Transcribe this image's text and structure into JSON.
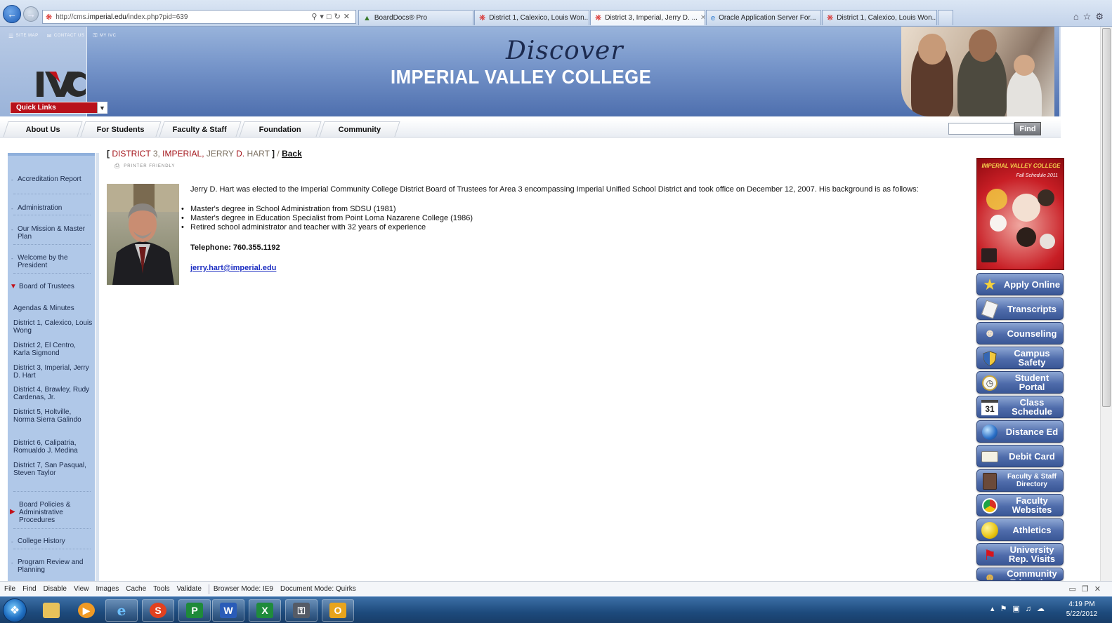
{
  "browser": {
    "address": "http://cms.imperial.edu/index.php?pid=639",
    "address_host": "imperial.edu",
    "address_prefix": "http://cms.",
    "address_suffix": "/index.php?pid=639",
    "tabs": [
      {
        "label": "BoardDocs® Pro",
        "active": false
      },
      {
        "label": "District 1, Calexico, Louis Won...",
        "active": false
      },
      {
        "label": "District 3, Imperial, Jerry D. ...",
        "active": true
      },
      {
        "label": "Oracle Application Server For...",
        "active": false
      },
      {
        "label": "District 1, Calexico, Louis Won...",
        "active": false
      }
    ]
  },
  "header": {
    "util_links": [
      "SITE MAP",
      "CONTACT US",
      "MY IVC"
    ],
    "quick_links": "Quick Links",
    "discover": "Discover",
    "college_name": "IMPERIAL VALLEY COLLEGE"
  },
  "nav": {
    "tabs": [
      "About Us",
      "For Students",
      "Faculty & Staff",
      "Foundation",
      "Community"
    ],
    "search_placeholder": "",
    "find_label": "Find"
  },
  "sidebar": {
    "items": [
      "Accreditation Report",
      "Administration",
      "Our Mission & Master Plan",
      "Welcome by the President",
      "Board of Trustees",
      "Board Policies & Administrative Procedures",
      "College History",
      "Program Review and Planning"
    ],
    "sub_items": [
      "Agendas & Minutes",
      "District 1, Calexico, Louis Wong",
      "District 2, El Centro, Karla Sigmond",
      "District 3, Imperial, Jerry D. Hart",
      "District 4, Brawley, Rudy Cardenas, Jr.",
      "District 5, Holtville, Norma Sierra Galindo",
      "District 6, Calipatria, Romualdo J. Medina",
      "District 7, San Pasqual, Steven Taylor"
    ]
  },
  "content": {
    "breadcrumb": {
      "open": "[",
      "district_word": "DISTRICT",
      "district_num": "3,",
      "city": "IMPERIAL,",
      "first": "JERRY",
      "initial": "D.",
      "last": "HART",
      "close": "]",
      "slash": "/",
      "back": "Back"
    },
    "printer_friendly": "PRINTER FRIENDLY",
    "bio": "Jerry D. Hart was elected to the Imperial Community College District Board of Trustees for Area 3 encompassing Imperial Unified School District and took office on December 12, 2007. His background is as follows:",
    "credentials": [
      "Master's degree in School Administration from SDSU (1981)",
      "Master's degree in Education Specialist from Point Loma Nazarene College (1986)",
      "Retired school administrator and teacher with 32 years of experience"
    ],
    "telephone": "Telephone: 760.355.1192",
    "email": "jerry.hart@imperial.edu"
  },
  "right_column": {
    "cover_title": "IMPERIAL VALLEY COLLEGE",
    "cover_subtitle": "Fall Schedule 2011",
    "buttons": [
      {
        "label": "Apply Online",
        "icon": "star-icon"
      },
      {
        "label": "Transcripts",
        "icon": "document-icon"
      },
      {
        "label": "Counseling",
        "icon": "people-icon"
      },
      {
        "label": "Campus Safety",
        "icon": "shield-icon"
      },
      {
        "label": "Student Portal",
        "icon": "clock-icon"
      },
      {
        "label": "Class Schedule",
        "icon": "calendar-icon",
        "icon_text": "31"
      },
      {
        "label": "Distance Ed",
        "icon": "globe-icon"
      },
      {
        "label": "Debit Card",
        "icon": "card-icon"
      },
      {
        "label": "Faculty & Staff Directory",
        "icon": "book-icon"
      },
      {
        "label": "Faculty Websites",
        "icon": "browser-icon"
      },
      {
        "label": "Athletics",
        "icon": "ball-icon"
      },
      {
        "label": "University Rep. Visits",
        "icon": "flag-icon"
      },
      {
        "label": "Community Education",
        "icon": "group-icon"
      }
    ]
  },
  "devbar": {
    "menus": [
      "File",
      "Find",
      "Disable",
      "View",
      "Images",
      "Cache",
      "Tools",
      "Validate"
    ],
    "browser_mode": "Browser Mode: IE9",
    "document_mode": "Document Mode: Quirks"
  },
  "taskbar": {
    "time": "4:19 PM",
    "date": "5/22/2012"
  },
  "colors": {
    "brand_red": "#b8111b",
    "banner_blue": "#7594c9",
    "sidebar_blue": "#b0c8e8",
    "button_blue": "#4f6cab",
    "link_blue": "#1c2ec2"
  }
}
